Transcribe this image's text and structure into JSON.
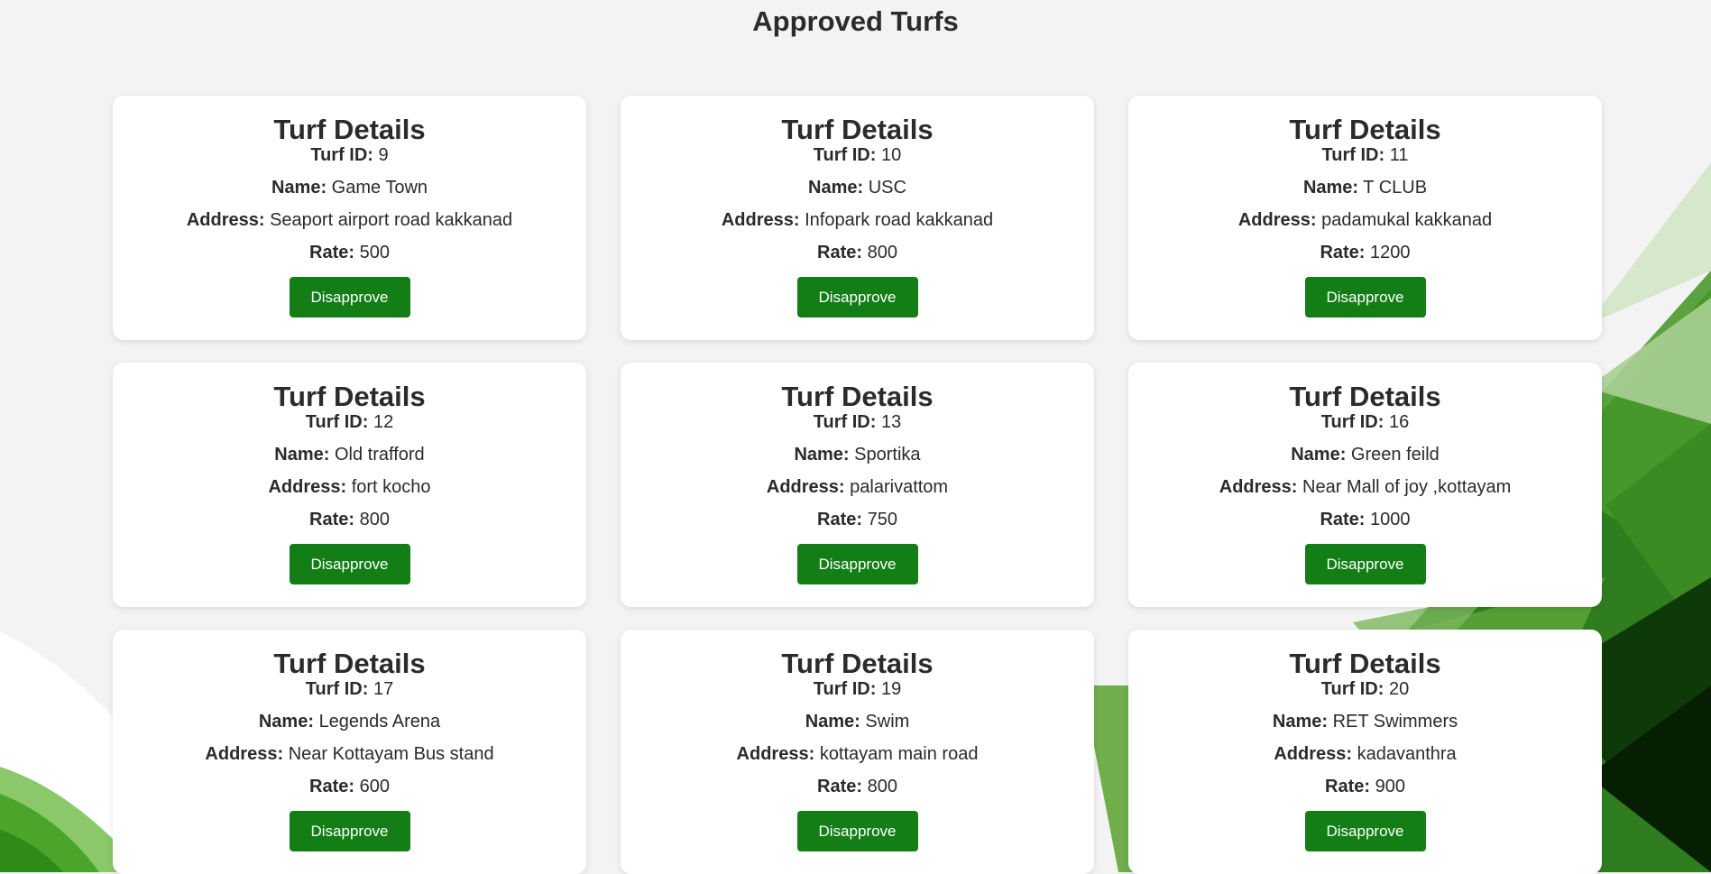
{
  "page": {
    "title": "Approved Turfs"
  },
  "labels": {
    "card_title": "Turf Details",
    "turf_id": "Turf ID:",
    "name": "Name:",
    "address": "Address:",
    "rate": "Rate:",
    "disapprove": "Disapprove"
  },
  "colors": {
    "button_bg": "#137e16",
    "page_bg": "#f3f3f3",
    "card_bg": "#ffffff"
  },
  "turfs": [
    {
      "id": "9",
      "name": "Game Town",
      "address": "Seaport airport road kakkanad",
      "rate": "500"
    },
    {
      "id": "10",
      "name": "USC",
      "address": "Infopark road kakkanad",
      "rate": "800"
    },
    {
      "id": "11",
      "name": "T CLUB",
      "address": "padamukal kakkanad",
      "rate": "1200"
    },
    {
      "id": "12",
      "name": "Old trafford",
      "address": "fort kocho",
      "rate": "800"
    },
    {
      "id": "13",
      "name": "Sportika",
      "address": "palarivattom",
      "rate": "750"
    },
    {
      "id": "16",
      "name": "Green feild",
      "address": "Near Mall of joy ,kottayam",
      "rate": "1000"
    },
    {
      "id": "17",
      "name": "Legends Arena",
      "address": "Near Kottayam Bus stand",
      "rate": "600"
    },
    {
      "id": "19",
      "name": "Swim",
      "address": "kottayam main road",
      "rate": "800"
    },
    {
      "id": "20",
      "name": "RET Swimmers",
      "address": "kadavanthra",
      "rate": "900"
    }
  ]
}
